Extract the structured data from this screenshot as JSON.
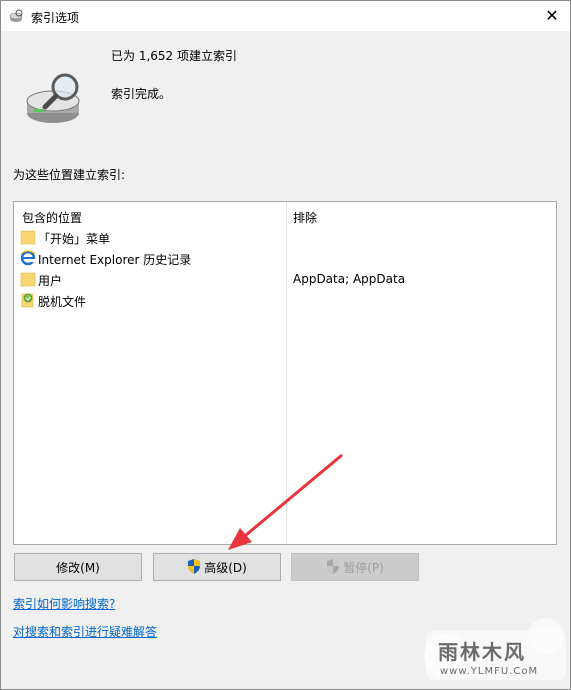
{
  "window": {
    "title": "索引选项",
    "close_glyph": "✕"
  },
  "summary": {
    "count_text": "已为 1,652 项建立索引",
    "status_text": "索引完成。"
  },
  "section_label": "为这些位置建立索引:",
  "table": {
    "columns": [
      "包含的位置",
      "排除"
    ],
    "rows": [
      {
        "icon": "folder-icon",
        "name": "「开始」菜单",
        "exclude": ""
      },
      {
        "icon": "ie-icon",
        "name": "Internet Explorer 历史记录",
        "exclude": ""
      },
      {
        "icon": "folder-icon",
        "name": "用户",
        "exclude": "AppData; AppData"
      },
      {
        "icon": "offline-files-icon",
        "name": "脱机文件",
        "exclude": ""
      }
    ]
  },
  "buttons": {
    "modify": "修改(M)",
    "advanced": "高级(D)",
    "pause": "暂停(P)"
  },
  "links": {
    "how_index_affects": "索引如何影响搜索?",
    "troubleshoot": "对搜索和索引进行疑难解答"
  },
  "watermark": {
    "main": "雨林木风",
    "sub": "www.YLMFU.CoM"
  },
  "colors": {
    "link": "#0066cc",
    "arrow": "#e8343a",
    "folder": "#f7d674"
  }
}
